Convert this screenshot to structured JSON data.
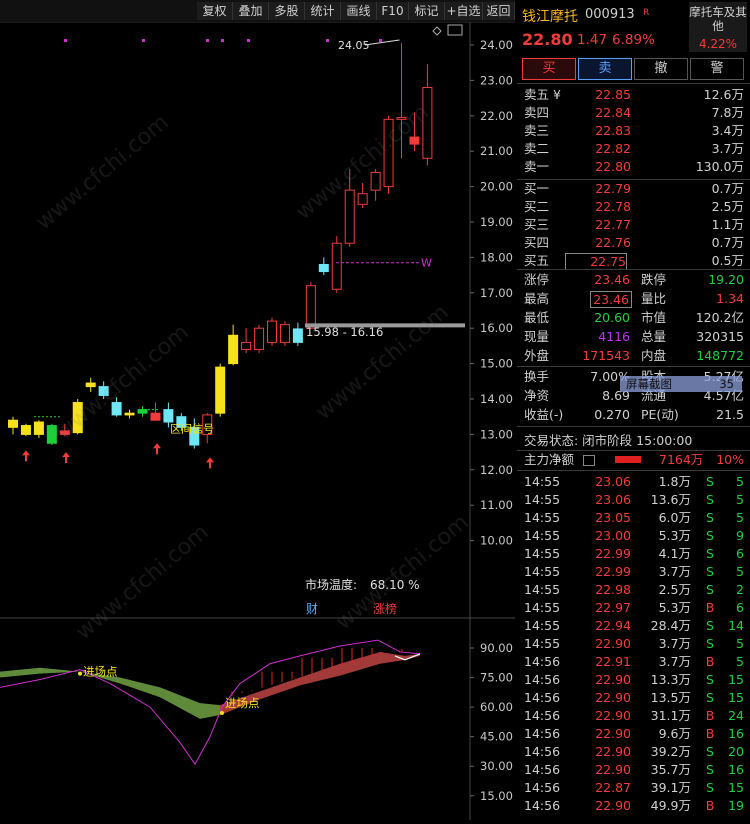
{
  "toolbar": {
    "buttons": [
      "复权",
      "叠加",
      "多股",
      "统计",
      "画线",
      "F10",
      "标记",
      "+自选",
      "返回"
    ]
  },
  "price_axis": [
    "24.00",
    "23.00",
    "22.00",
    "21.00",
    "20.00",
    "19.00",
    "18.00",
    "17.00",
    "16.00",
    "15.00",
    "14.00",
    "13.00",
    "12.00",
    "11.00",
    "10.00"
  ],
  "indicator_axis": [
    "90.00",
    "75.00",
    "60.00",
    "45.00",
    "30.00",
    "15.00"
  ],
  "annotations": {
    "high_label": "24.05",
    "w_label": "W",
    "range_label": "15.98 - 16.16",
    "zone_label": "区间信号",
    "market_temp_label": "市场温度:",
    "market_temp_value": "68.10 %",
    "cai": "财",
    "zhangbang": "涨榜",
    "entry_point_1": "进场点",
    "entry_point_2": "进场点"
  },
  "watermark": "www.cfchi.com",
  "header": {
    "name": "钱江摩托",
    "code": "000913",
    "tag": "R",
    "sector_name": "摩托车及其他",
    "sector_change": "4.22%",
    "price": "22.80",
    "change": "1.47",
    "change_pct": "6.89%"
  },
  "actions": [
    "买",
    "卖",
    "撤",
    "警"
  ],
  "asks": [
    {
      "label": "卖五 ¥",
      "price": "22.85",
      "vol": "12.6万"
    },
    {
      "label": "卖四",
      "price": "22.84",
      "vol": "7.8万"
    },
    {
      "label": "卖三",
      "price": "22.83",
      "vol": "3.4万"
    },
    {
      "label": "卖二",
      "price": "22.82",
      "vol": "3.7万"
    },
    {
      "label": "卖一",
      "price": "22.80",
      "vol": "130.0万"
    }
  ],
  "bids": [
    {
      "label": "买一",
      "price": "22.79",
      "vol": "0.7万"
    },
    {
      "label": "买二",
      "price": "22.78",
      "vol": "2.5万"
    },
    {
      "label": "买三",
      "price": "22.77",
      "vol": "1.1万"
    },
    {
      "label": "买四",
      "price": "22.76",
      "vol": "0.7万"
    },
    {
      "label": "买五",
      "price": "22.75",
      "vol": "0.5万"
    }
  ],
  "stats": {
    "zhangting_l": "涨停",
    "zhangting": "23.46",
    "dieting_l": "跌停",
    "dieting": "19.20",
    "zuigao_l": "最高",
    "zuigao": "23.46",
    "liangbi_l": "量比",
    "liangbi": "1.34",
    "zuidi_l": "最低",
    "zuidi": "20.60",
    "shizhi_l": "市值",
    "shizhi": "120.2亿",
    "xianliang_l": "现量",
    "xianliang": "4116",
    "zongliang_l": "总量",
    "zongliang": "320315",
    "waipan_l": "外盘",
    "waipan": "171543",
    "neipan_l": "内盘",
    "neipan": "148772",
    "huanshou_l": "换手",
    "huanshou": "7.00%",
    "guben_l": "股本",
    "guben": "5.27亿",
    "jingzi_l": "净资",
    "jingzi": "8.69",
    "liutong_l": "流通",
    "liutong": "4.57亿",
    "shouyi_l": "收益(-)",
    "shouyi": "0.270",
    "pe_l": "PE(动)",
    "pe": "21.5"
  },
  "screenshot_popup": {
    "label": "屏幕截图",
    "value": "35"
  },
  "trade_status": "交易状态: 闭市阶段 15:00:00",
  "main_flow": {
    "label": "主力净额",
    "value": "7164万",
    "pct": "10%"
  },
  "trades": [
    {
      "t": "14:55",
      "p": "23.06",
      "v": "1.8万",
      "d": "S",
      "n": "5",
      "pc": "red",
      "dc": "green"
    },
    {
      "t": "14:55",
      "p": "23.06",
      "v": "13.6万",
      "d": "S",
      "n": "5",
      "pc": "red",
      "dc": "green"
    },
    {
      "t": "14:55",
      "p": "23.05",
      "v": "6.0万",
      "d": "S",
      "n": "5",
      "pc": "red",
      "dc": "green"
    },
    {
      "t": "14:55",
      "p": "23.00",
      "v": "5.3万",
      "d": "S",
      "n": "9",
      "pc": "red",
      "dc": "green"
    },
    {
      "t": "14:55",
      "p": "22.99",
      "v": "4.1万",
      "d": "S",
      "n": "6",
      "pc": "red",
      "dc": "green"
    },
    {
      "t": "14:55",
      "p": "22.99",
      "v": "3.7万",
      "d": "S",
      "n": "5",
      "pc": "red",
      "dc": "green"
    },
    {
      "t": "14:55",
      "p": "22.98",
      "v": "2.5万",
      "d": "S",
      "n": "2",
      "pc": "red",
      "dc": "green"
    },
    {
      "t": "14:55",
      "p": "22.97",
      "v": "5.3万",
      "d": "B",
      "n": "6",
      "pc": "red",
      "dc": "red"
    },
    {
      "t": "14:55",
      "p": "22.94",
      "v": "28.4万",
      "d": "S",
      "n": "14",
      "pc": "red",
      "dc": "green"
    },
    {
      "t": "14:55",
      "p": "22.90",
      "v": "3.7万",
      "d": "S",
      "n": "5",
      "pc": "red",
      "dc": "green"
    },
    {
      "t": "14:56",
      "p": "22.91",
      "v": "3.7万",
      "d": "B",
      "n": "5",
      "pc": "red",
      "dc": "red"
    },
    {
      "t": "14:56",
      "p": "22.90",
      "v": "13.3万",
      "d": "S",
      "n": "15",
      "pc": "red",
      "dc": "green"
    },
    {
      "t": "14:56",
      "p": "22.90",
      "v": "13.5万",
      "d": "S",
      "n": "15",
      "pc": "red",
      "dc": "green"
    },
    {
      "t": "14:56",
      "p": "22.90",
      "v": "31.1万",
      "d": "B",
      "n": "24",
      "pc": "red",
      "dc": "red"
    },
    {
      "t": "14:56",
      "p": "22.90",
      "v": "9.6万",
      "d": "B",
      "n": "16",
      "pc": "red",
      "dc": "red"
    },
    {
      "t": "14:56",
      "p": "22.90",
      "v": "39.2万",
      "d": "S",
      "n": "20",
      "pc": "red",
      "dc": "green"
    },
    {
      "t": "14:56",
      "p": "22.90",
      "v": "35.7万",
      "d": "S",
      "n": "16",
      "pc": "red",
      "dc": "green"
    },
    {
      "t": "14:56",
      "p": "22.87",
      "v": "39.1万",
      "d": "S",
      "n": "15",
      "pc": "red",
      "dc": "green"
    },
    {
      "t": "14:56",
      "p": "22.90",
      "v": "49.9万",
      "d": "B",
      "n": "19",
      "pc": "red",
      "dc": "red"
    }
  ],
  "candles": [
    {
      "o": 13.2,
      "h": 13.5,
      "l": 13.0,
      "c": 13.4
    },
    {
      "o": 13.0,
      "h": 13.3,
      "l": 12.95,
      "c": 13.25
    },
    {
      "o": 13.0,
      "h": 13.4,
      "l": 12.9,
      "c": 13.35
    },
    {
      "o": 12.75,
      "h": 13.3,
      "l": 12.7,
      "c": 13.25
    },
    {
      "o": 13.1,
      "h": 13.3,
      "l": 12.95,
      "c": 13.0
    },
    {
      "o": 13.05,
      "h": 14.0,
      "l": 13.0,
      "c": 13.9
    },
    {
      "o": 14.35,
      "h": 14.6,
      "l": 14.2,
      "c": 14.45
    },
    {
      "o": 14.35,
      "h": 14.5,
      "l": 14.0,
      "c": 14.1
    },
    {
      "o": 13.9,
      "h": 14.05,
      "l": 13.5,
      "c": 13.55
    },
    {
      "o": 13.55,
      "h": 13.7,
      "l": 13.45,
      "c": 13.6
    },
    {
      "o": 13.6,
      "h": 13.8,
      "l": 13.5,
      "c": 13.7
    },
    {
      "o": 13.6,
      "h": 13.9,
      "l": 13.4,
      "c": 13.4
    },
    {
      "o": 13.7,
      "h": 13.9,
      "l": 13.2,
      "c": 13.35
    },
    {
      "o": 13.5,
      "h": 13.6,
      "l": 13.1,
      "c": 13.2
    },
    {
      "o": 13.2,
      "h": 13.45,
      "l": 12.6,
      "c": 12.7
    },
    {
      "o": 13.0,
      "h": 13.6,
      "l": 12.75,
      "c": 13.55
    },
    {
      "o": 13.6,
      "h": 15.0,
      "l": 13.5,
      "c": 14.9
    },
    {
      "o": 15.0,
      "h": 16.1,
      "l": 14.95,
      "c": 15.8
    },
    {
      "o": 15.4,
      "h": 16.0,
      "l": 15.3,
      "c": 15.6
    },
    {
      "o": 15.4,
      "h": 16.1,
      "l": 15.3,
      "c": 16.0
    },
    {
      "o": 15.6,
      "h": 16.3,
      "l": 15.5,
      "c": 16.2
    },
    {
      "o": 15.6,
      "h": 16.2,
      "l": 15.5,
      "c": 16.1
    },
    {
      "o": 15.98,
      "h": 16.16,
      "l": 15.5,
      "c": 15.6
    },
    {
      "o": 16.0,
      "h": 17.3,
      "l": 15.98,
      "c": 17.2
    },
    {
      "o": 17.8,
      "h": 18.0,
      "l": 17.5,
      "c": 17.6
    },
    {
      "o": 17.1,
      "h": 18.6,
      "l": 17.0,
      "c": 18.4
    },
    {
      "o": 18.4,
      "h": 20.5,
      "l": 18.3,
      "c": 19.9
    },
    {
      "o": 19.5,
      "h": 20.1,
      "l": 19.4,
      "c": 19.8
    },
    {
      "o": 19.9,
      "h": 20.5,
      "l": 19.6,
      "c": 20.4
    },
    {
      "o": 20.0,
      "h": 22.0,
      "l": 19.8,
      "c": 21.9
    },
    {
      "o": 21.9,
      "h": 24.05,
      "l": 20.8,
      "c": 21.95
    },
    {
      "o": 21.4,
      "h": 22.1,
      "l": 21.0,
      "c": 21.2
    },
    {
      "o": 20.8,
      "h": 23.46,
      "l": 20.6,
      "c": 22.8
    }
  ],
  "colors": {
    "up": "#f23b3b",
    "down": "#1fcf3a",
    "up_hollow": "#f23b3b",
    "yellow": "#f5e21a",
    "cyan": "#6fe7f7",
    "magenta": "#d02ed0",
    "grid": "#333333"
  }
}
